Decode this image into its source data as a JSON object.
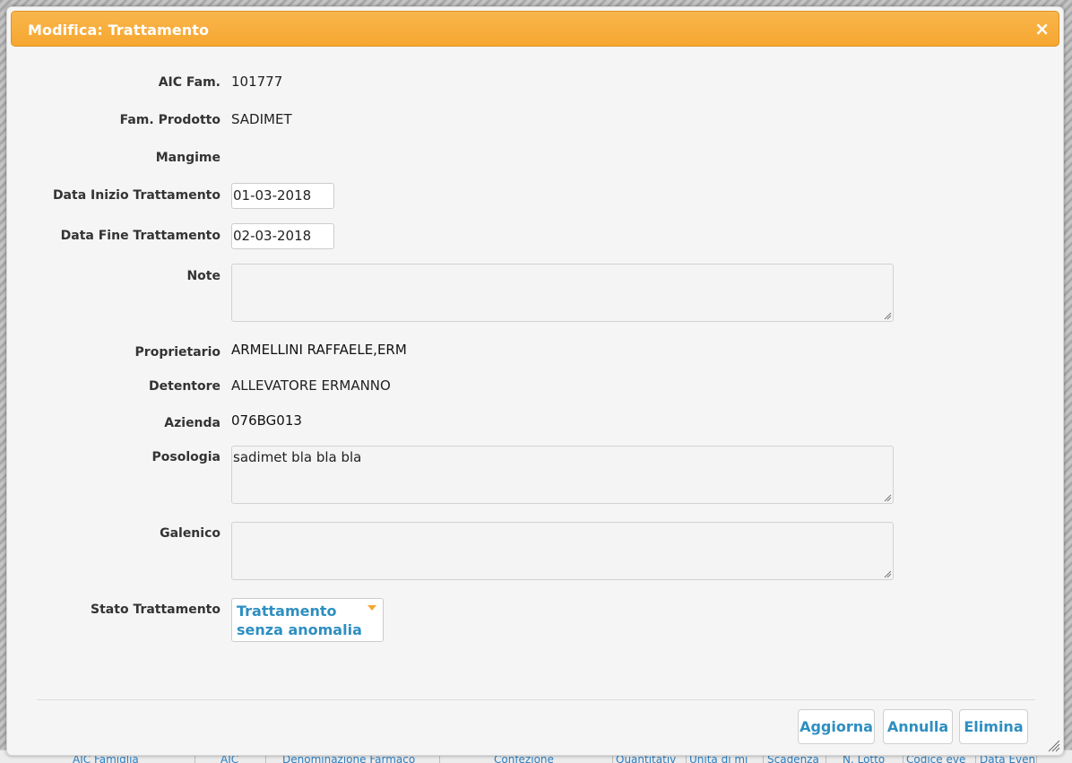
{
  "dialog": {
    "title": "Modifica: Trattamento",
    "close_glyph": "×"
  },
  "fields": {
    "aic_fam": {
      "label": "AIC Fam.",
      "value": "101777"
    },
    "fam_prodotto": {
      "label": "Fam. Prodotto",
      "value": "SADIMET"
    },
    "mangime": {
      "label": "Mangime",
      "value": ""
    },
    "data_inizio": {
      "label": "Data Inizio Trattamento",
      "value": "01-03-2018"
    },
    "data_fine": {
      "label": "Data Fine Trattamento",
      "value": "02-03-2018"
    },
    "note": {
      "label": "Note",
      "value": ""
    },
    "proprietario": {
      "label": "Proprietario",
      "value": "ARMELLINI RAFFAELE,ERM"
    },
    "detentore": {
      "label": "Detentore",
      "value": "ALLEVATORE ERMANNO"
    },
    "azienda": {
      "label": "Azienda",
      "value": "076BG013"
    },
    "posologia": {
      "label": "Posologia",
      "value": "sadimet bla bla bla"
    },
    "galenico": {
      "label": "Galenico",
      "value": ""
    },
    "stato": {
      "label": "Stato Trattamento",
      "value": "Trattamento senza anomalia"
    }
  },
  "buttons": {
    "aggiorna": "Aggiorna",
    "annulla": "Annulla",
    "elimina": "Elimina"
  },
  "background_table": {
    "columns": [
      "AIC Famiglia",
      "AIC",
      "Denominazione Farmaco",
      "Confezione",
      "Quantitativ",
      "Unità di mi",
      "Scadenza",
      "N. Lotto",
      "Codice eve",
      "Data Even"
    ]
  },
  "colors": {
    "title_bar": "#f6a730",
    "accent_text": "#2d8fc1"
  }
}
